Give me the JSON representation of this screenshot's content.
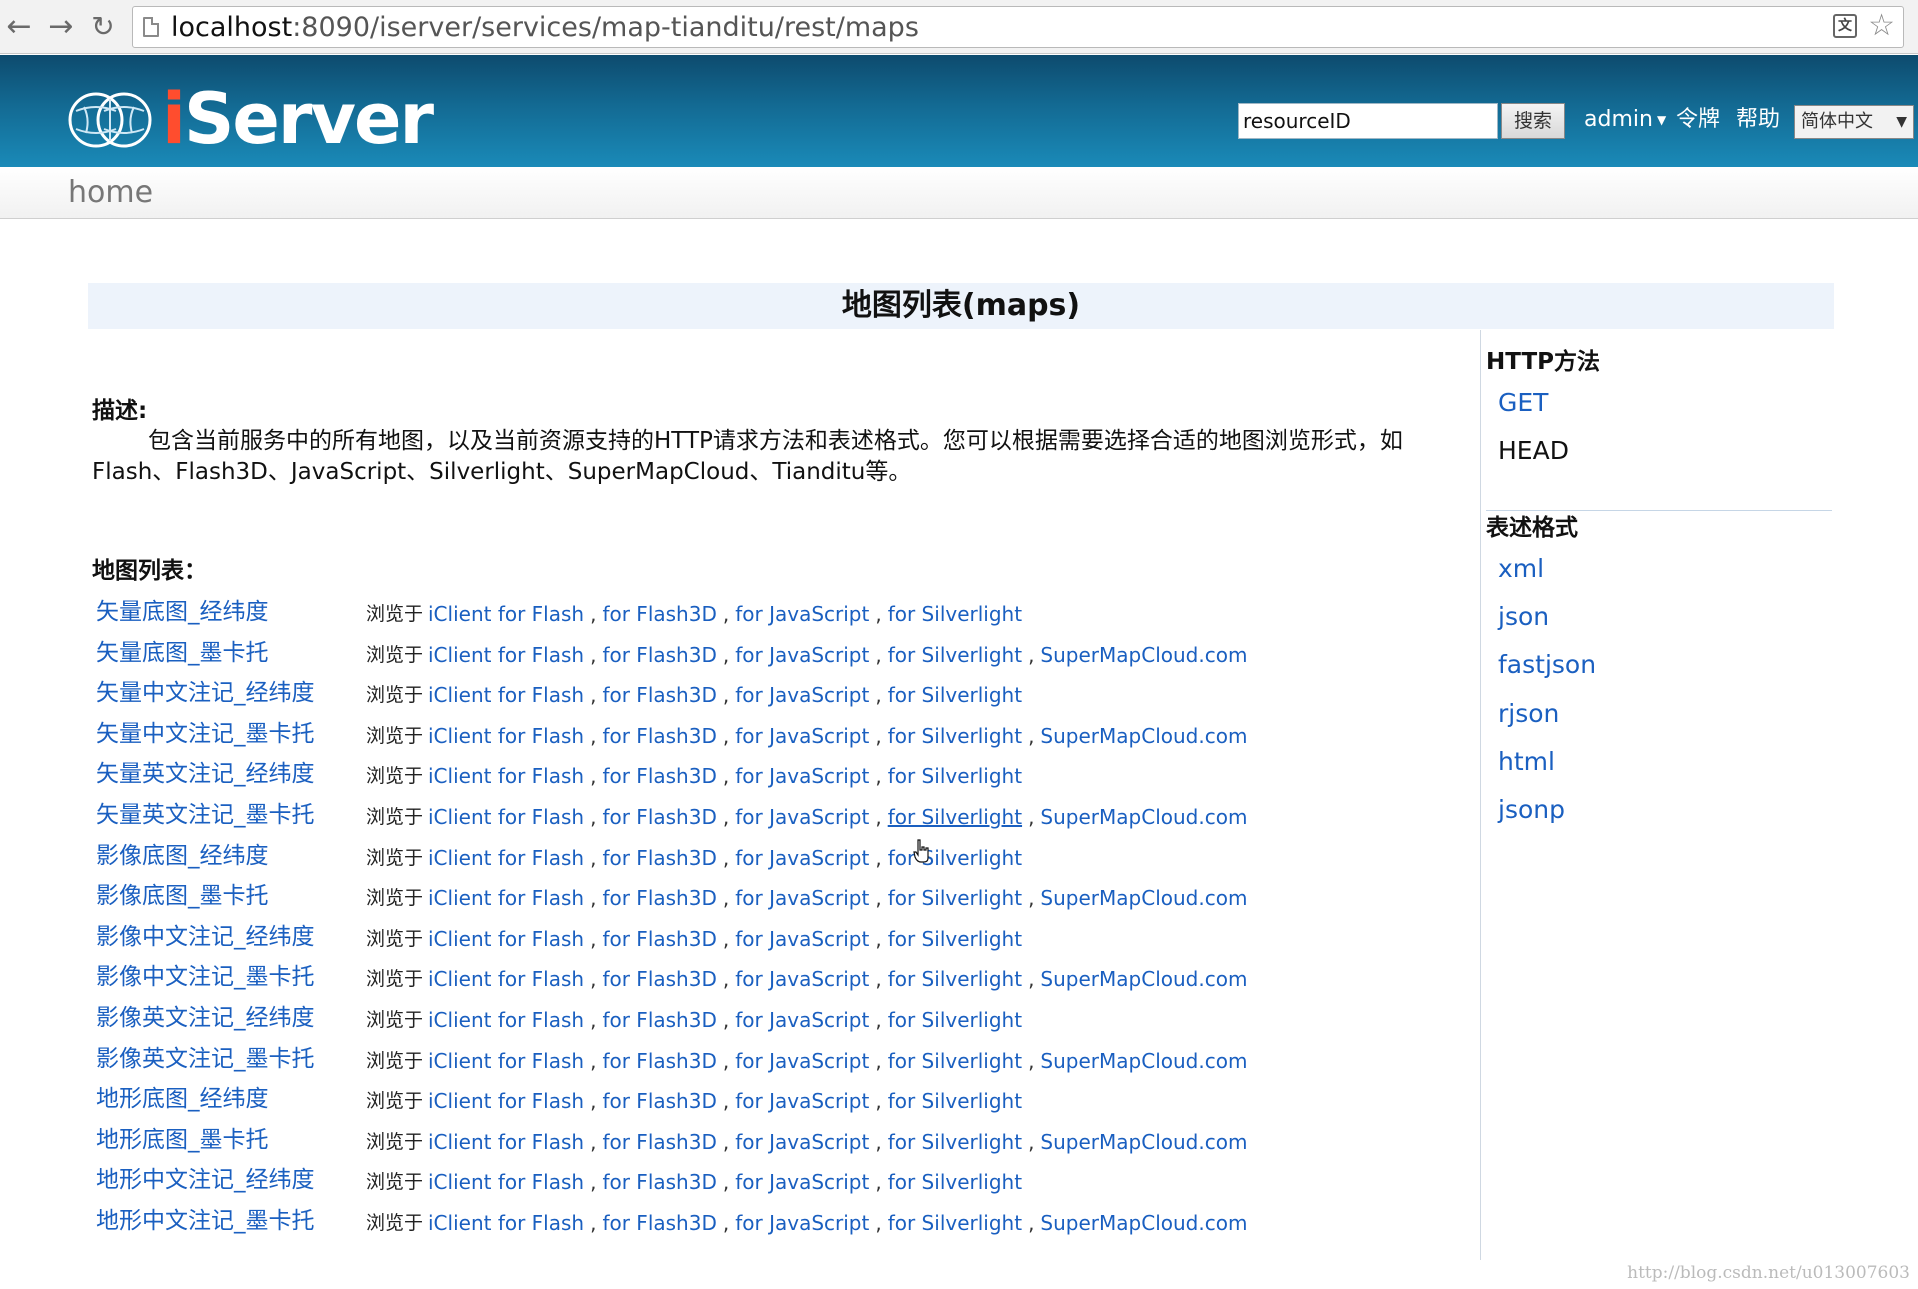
{
  "browser": {
    "url_host": "localhost",
    "url_rest": ":8090/iserver/services/map-tianditu/rest/maps"
  },
  "header": {
    "logo_i": "i",
    "logo_rest": "Server",
    "search_value": "resourceID",
    "search_button": "搜索",
    "user": "admin",
    "token": "令牌",
    "help": "帮助",
    "language": "简体中文"
  },
  "breadcrumb": {
    "home": "home"
  },
  "page_title": "地图列表(maps)",
  "description": {
    "label": "描述:",
    "text": "包含当前服务中的所有地图，以及当前资源支持的HTTP请求方法和表述格式。您可以根据需要选择合适的地图浏览形式，如Flash、Flash3D、JavaScript、Silverlight、SuperMapCloud、Tianditu等。"
  },
  "map_list": {
    "label": "地图列表：",
    "browse_prefix": "浏览于",
    "link_labels": {
      "flash": "iClient for Flash",
      "flash3d": "for Flash3D",
      "js": "for JavaScript",
      "silverlight": "for Silverlight",
      "cloud": "SuperMapCloud.com"
    },
    "sep": ",",
    "maps": [
      {
        "name": "矢量底图_经纬度",
        "cloud": false
      },
      {
        "name": "矢量底图_墨卡托",
        "cloud": true
      },
      {
        "name": "矢量中文注记_经纬度",
        "cloud": false
      },
      {
        "name": "矢量中文注记_墨卡托",
        "cloud": true
      },
      {
        "name": "矢量英文注记_经纬度",
        "cloud": false
      },
      {
        "name": "矢量英文注记_墨卡托",
        "cloud": true
      },
      {
        "name": "影像底图_经纬度",
        "cloud": false
      },
      {
        "name": "影像底图_墨卡托",
        "cloud": true
      },
      {
        "name": "影像中文注记_经纬度",
        "cloud": false
      },
      {
        "name": "影像中文注记_墨卡托",
        "cloud": true
      },
      {
        "name": "影像英文注记_经纬度",
        "cloud": false
      },
      {
        "name": "影像英文注记_墨卡托",
        "cloud": true
      },
      {
        "name": "地形底图_经纬度",
        "cloud": false
      },
      {
        "name": "地形底图_墨卡托",
        "cloud": true
      },
      {
        "name": "地形中文注记_经纬度",
        "cloud": false
      },
      {
        "name": "地形中文注记_墨卡托",
        "cloud": true
      }
    ]
  },
  "sidebar": {
    "http_heading": "HTTP方法",
    "http_methods": [
      {
        "label": "GET",
        "link": true
      },
      {
        "label": "HEAD",
        "link": false
      }
    ],
    "format_heading": "表述格式",
    "formats": [
      "xml",
      "json",
      "fastjson",
      "rjson",
      "html",
      "jsonp"
    ]
  },
  "watermark": "http://blog.csdn.net/u013007603",
  "colors": {
    "link": "#1a5fc0",
    "header_dark": "#0d4b6e",
    "header_light": "#1a8ab8",
    "logo_accent": "#ff4d2e",
    "title_band": "#edf3fb"
  }
}
